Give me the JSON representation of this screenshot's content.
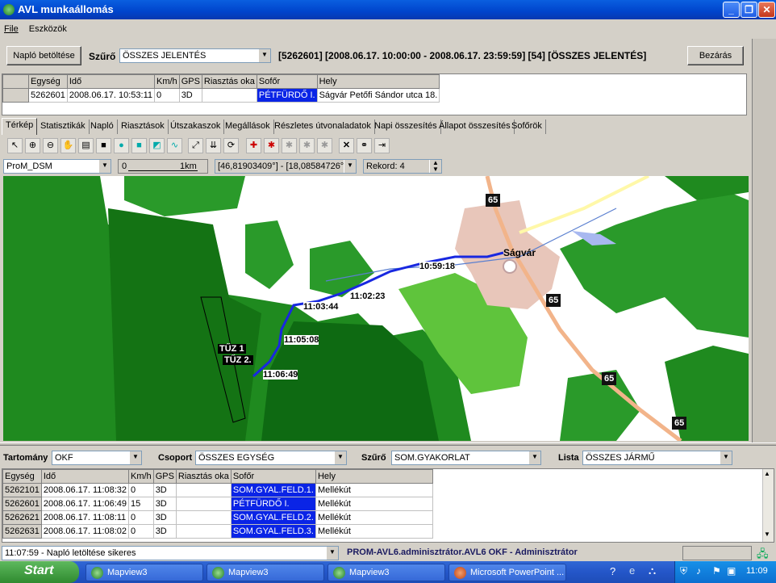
{
  "window": {
    "title": "AVL munkaállomás",
    "min": "_",
    "max": "❐",
    "close": "✕"
  },
  "menu": {
    "file": "File",
    "tools": "Eszközök"
  },
  "top": {
    "load_btn": "Napló betöltése",
    "filter_label": "Szűrő",
    "filter_value": "ÖSSZES JELENTÉS",
    "summary": "[5262601] [2008.06.17. 10:00:00 - 2008.06.17. 23:59:59] [54] [ÖSSZES JELENTÉS]",
    "close_btn": "Bezárás"
  },
  "unit_table": {
    "headers": [
      "",
      "Egység",
      "Idő",
      "Km/h",
      "GPS",
      "Riasztás oka",
      "Sofőr",
      "Hely"
    ],
    "row": [
      "",
      "5262601",
      "2008.06.17. 10:53:11",
      "0",
      "3D",
      "",
      "PÉTFÜRDŐ I.",
      "Ságvár Petőfi Sándor utca 18."
    ]
  },
  "tabs": [
    "Térkép",
    "Statisztikák",
    "Napló",
    "Riasztások",
    "Útszakaszok",
    "Megállások",
    "Részletes útvonaladatok",
    "Napi összesítés",
    "Állapot összesítés",
    "Sofőrök"
  ],
  "toolbar": {
    "layer": "ProM_DSM",
    "scale_left": "0",
    "scale_right": "1km",
    "coords": "[46,81903409°] - [18,08584726°]",
    "record": "Rekord: 4"
  },
  "map": {
    "town": "Ságvár",
    "road_labels": [
      "65",
      "65",
      "65",
      "65"
    ],
    "track_labels": [
      "10:59:18",
      "11:02:23",
      "11:03:44",
      "11:05:08",
      "11:06:49"
    ],
    "fire_labels": [
      "TŰZ 1",
      "TŰZ 2."
    ]
  },
  "bottom_filters": {
    "domain_label": "Tartomány",
    "domain_value": "OKF",
    "group_label": "Csoport",
    "group_value": "ÖSSZES EGYSÉG",
    "filter_label": "Szűrő",
    "filter_value": "SOM.GYAKORLAT",
    "list_label": "Lista",
    "list_value": "ÖSSZES JÁRMŰ"
  },
  "vehicles": {
    "headers": [
      "Egység",
      "Idő",
      "Km/h",
      "GPS",
      "Riasztás oka",
      "Sofőr",
      "Hely"
    ],
    "rows": [
      [
        "5262101",
        "2008.06.17. 11:08:32",
        "0",
        "3D",
        "",
        "SOM.GYAL.FELD.1.",
        "Mellékút"
      ],
      [
        "5262601",
        "2008.06.17. 11:06:49",
        "15",
        "3D",
        "",
        "PÉTFÜRDŐ I.",
        "Mellékút"
      ],
      [
        "5262621",
        "2008.06.17. 11:08:11",
        "0",
        "3D",
        "",
        "SOM.GYAL.FELD.2.",
        "Mellékút"
      ],
      [
        "5262631",
        "2008.06.17. 11:08:02",
        "0",
        "3D",
        "",
        "SOM.GYAL.FELD.3.",
        "Mellékút"
      ]
    ]
  },
  "status": {
    "log": "11:07:59 - Napló letöltése sikeres",
    "user": "PROM-AVL6.adminisztrátor.AVL6 OKF - Adminisztrátor"
  },
  "taskbar": {
    "start": "Start",
    "tasks": [
      "Mapview3",
      "Mapview3",
      "Mapview3",
      "Microsoft PowerPoint ..."
    ],
    "clock": "11:09"
  }
}
